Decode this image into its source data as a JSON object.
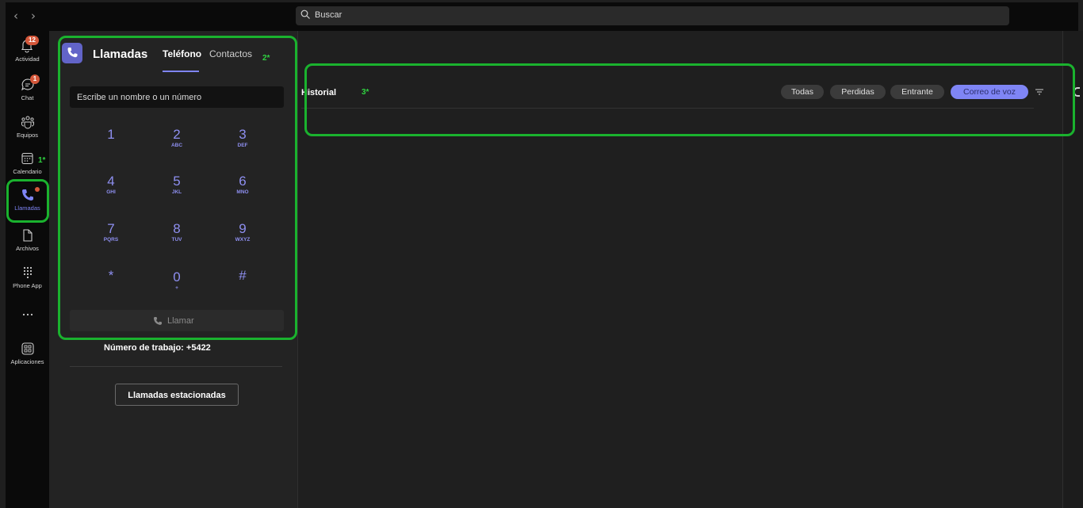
{
  "topbar": {
    "back_icon": "chevron-left-icon",
    "forward_icon": "chevron-right-icon",
    "search_placeholder": "Buscar"
  },
  "rail": {
    "items": [
      {
        "label": "Actividad",
        "icon": "bell-icon",
        "badge": "12"
      },
      {
        "label": "Chat",
        "icon": "chat-icon",
        "badge": "1"
      },
      {
        "label": "Equipos",
        "icon": "teams-icon"
      },
      {
        "label": "Calendario",
        "icon": "calendar-icon"
      },
      {
        "label": "Llamadas",
        "icon": "phone-icon",
        "active": true
      },
      {
        "label": "Archivos",
        "icon": "file-icon"
      },
      {
        "label": "Phone App",
        "icon": "dialpad-icon"
      },
      {
        "label": "",
        "icon": "more-icon"
      },
      {
        "label": "Aplicaciones",
        "icon": "apps-icon"
      }
    ]
  },
  "annotations": {
    "one": "1*",
    "two": "2*",
    "three": "3*"
  },
  "calls": {
    "title": "Llamadas",
    "tabs": [
      {
        "label": "Teléfono",
        "active": true
      },
      {
        "label": "Contactos",
        "active": false
      }
    ],
    "dial_input_placeholder": "Escribe un nombre o un número",
    "keypad": [
      {
        "digit": "1",
        "letters": ""
      },
      {
        "digit": "2",
        "letters": "ABC"
      },
      {
        "digit": "3",
        "letters": "DEF"
      },
      {
        "digit": "4",
        "letters": "GHI"
      },
      {
        "digit": "5",
        "letters": "JKL"
      },
      {
        "digit": "6",
        "letters": "MNO"
      },
      {
        "digit": "7",
        "letters": "PQRS"
      },
      {
        "digit": "8",
        "letters": "TUV"
      },
      {
        "digit": "9",
        "letters": "WXYZ"
      },
      {
        "digit": "*",
        "letters": ""
      },
      {
        "digit": "0",
        "letters": "+"
      },
      {
        "digit": "#",
        "letters": ""
      }
    ],
    "call_button": "Llamar",
    "work_number": "Número de trabajo: +5422",
    "parked_calls_button": "Llamadas estacionadas"
  },
  "history": {
    "title": "Historial",
    "filters": [
      {
        "label": "Todas",
        "active": false
      },
      {
        "label": "Perdidas",
        "active": false
      },
      {
        "label": "Entrante",
        "active": false
      },
      {
        "label": "Correo de voz",
        "active": true
      }
    ],
    "filter_icon": "filter-icon"
  },
  "colors": {
    "accent": "#7f85f5",
    "highlight": "#1ab22e",
    "badge": "#d4573a",
    "background": "#1f1f1f"
  }
}
